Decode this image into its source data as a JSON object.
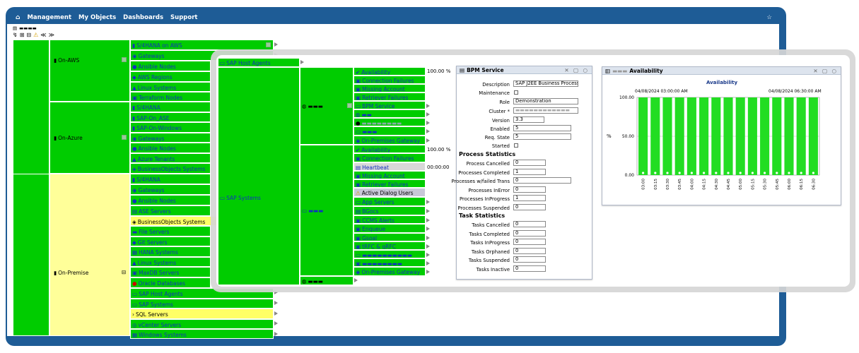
{
  "menu": {
    "home_icon": "⌂",
    "items": [
      "Management",
      "My Objects",
      "Dashboards",
      "Support"
    ],
    "star_icon": "☆"
  },
  "breadcrumb": {
    "icon": "folder-icon",
    "text": "▬▬▬▬"
  },
  "toolbar": {
    "icons": [
      "refresh-icon",
      "tree-icon",
      "filter-icon",
      "warning-icon",
      "collapse-icon",
      "expand-icon"
    ],
    "collapse": "≪",
    "expand": "≫"
  },
  "colors": {
    "ok": "#00cc00",
    "warn": "#ffff66",
    "menu": "#1e5c96",
    "chart_bar": "#22dd22"
  },
  "tree": {
    "root_label": "▬▬▬▬",
    "groups": [
      {
        "label": "On-AWS",
        "items": [
          "S/4HANA on AWS",
          "Gateways",
          "Ansible Nodes",
          "AWS Regions",
          "Linux Systems",
          "Terraform Nodes"
        ]
      },
      {
        "label": "On-Azure",
        "items": [
          "S/4HANA",
          "SAP-On_ASE",
          "SAP-On-Windows",
          "Gateways",
          "Ansible Nodes",
          "Azure Tenants",
          "BusinessObjects Systems"
        ]
      },
      {
        "label": "On-Premise",
        "items": [
          "S/4HANA",
          "Gateways",
          "Ansible Nodes",
          "ASE Servers",
          "BusinessObjects Systems",
          "File Servers",
          "Git Servers",
          "HANA Systems",
          "Linux Systems",
          "MaxDB Servers",
          "Oracle Databases",
          "SAP Host Agents",
          "SAP Systems",
          "SQL Servers",
          "vCenter Servers",
          "Windows Systems"
        ]
      }
    ],
    "level3": {
      "host_agents": "SAP Host Agents",
      "systems": "SAP Systems"
    },
    "level4": [
      "▬▬▬",
      "▬▬▬",
      "▬▬▬"
    ],
    "level5_a": [
      "Availability",
      "Connection Failures",
      "Missing Account",
      "Retriever Failures",
      "BPM Service",
      "▬▬",
      "▬▬▬▬▬▬▬▬",
      "▬▬▬",
      "On-Premises Gateway"
    ],
    "level5_b": [
      "Availability",
      "Connection Failures",
      "Heartbeat",
      "Missing Account",
      "Retriever Failures",
      "Active Dialog Users",
      "App Servers",
      "BGocs",
      "CCMS Alerts",
      "Enqueue",
      "Gsoal",
      "tRFC & qRFC",
      "▬▬▬▬▬▬▬▬▬▬",
      "▬▬▬▬▬▬▬▬",
      "On-Premises Gateway"
    ],
    "values": {
      "avail_a": "100.00 %",
      "avail_b": "100.00 %",
      "heartbeat": "00:00:00"
    }
  },
  "bpm_panel": {
    "title": "BPM Service",
    "controls": "✕ ▢ ○",
    "fields": [
      {
        "label": "Description",
        "value": "SAP J2EE Business Process ..."
      },
      {
        "label": "Maintenance",
        "value": ""
      },
      {
        "label": "Role",
        "value": "Demonstration"
      },
      {
        "label": "Cluster *",
        "value": "▬▬▬▬▬▬▬▬▬▬▬▬"
      },
      {
        "label": "Version",
        "value": "3.3"
      },
      {
        "label": "Enabled",
        "value": "5"
      },
      {
        "label": "Req. State",
        "value": "5"
      },
      {
        "label": "Started",
        "value": ""
      }
    ],
    "process_title": "Process Statistics",
    "process": [
      {
        "label": "Process Cancelled",
        "value": "0"
      },
      {
        "label": "Processes Completed",
        "value": "1"
      },
      {
        "label": "Processes w/failed Trans",
        "value": "0"
      },
      {
        "label": "Processes InError",
        "value": "0"
      },
      {
        "label": "Processes InProgress",
        "value": "1"
      },
      {
        "label": "Processes Suspended",
        "value": "0"
      }
    ],
    "task_title": "Task Statistics",
    "tasks": [
      {
        "label": "Tasks Cancelled",
        "value": "0"
      },
      {
        "label": "Tasks Completed",
        "value": "0"
      },
      {
        "label": "Tasks InProgress",
        "value": "0"
      },
      {
        "label": "Tasks Orphaned",
        "value": "0"
      },
      {
        "label": "Tasks Suspended",
        "value": "0"
      },
      {
        "label": "Tasks Inactive",
        "value": "0"
      }
    ]
  },
  "avail_panel": {
    "title_prefix": "▬▬▬",
    "title": "Availability",
    "controls": "✕ ▢ ○"
  },
  "chart_data": {
    "type": "bar",
    "title": "Availability",
    "start_label": "04/08/2024 03:00:00 AM",
    "end_label": "04/08/2024 06:30:00 AM",
    "ylabel": "%",
    "yticks": [
      "100.00",
      "50.00",
      "0.00"
    ],
    "ylim": [
      0,
      100
    ],
    "categories": [
      "03:00",
      "03:15",
      "03:30",
      "03:45",
      "04:00",
      "04:15",
      "04:30",
      "04:45",
      "05:00",
      "05:15",
      "05:30",
      "05:45",
      "06:00",
      "06:15",
      "06:30"
    ],
    "values": [
      100,
      100,
      100,
      100,
      100,
      100,
      100,
      100,
      100,
      100,
      100,
      100,
      100,
      100,
      100
    ],
    "grid": true
  }
}
